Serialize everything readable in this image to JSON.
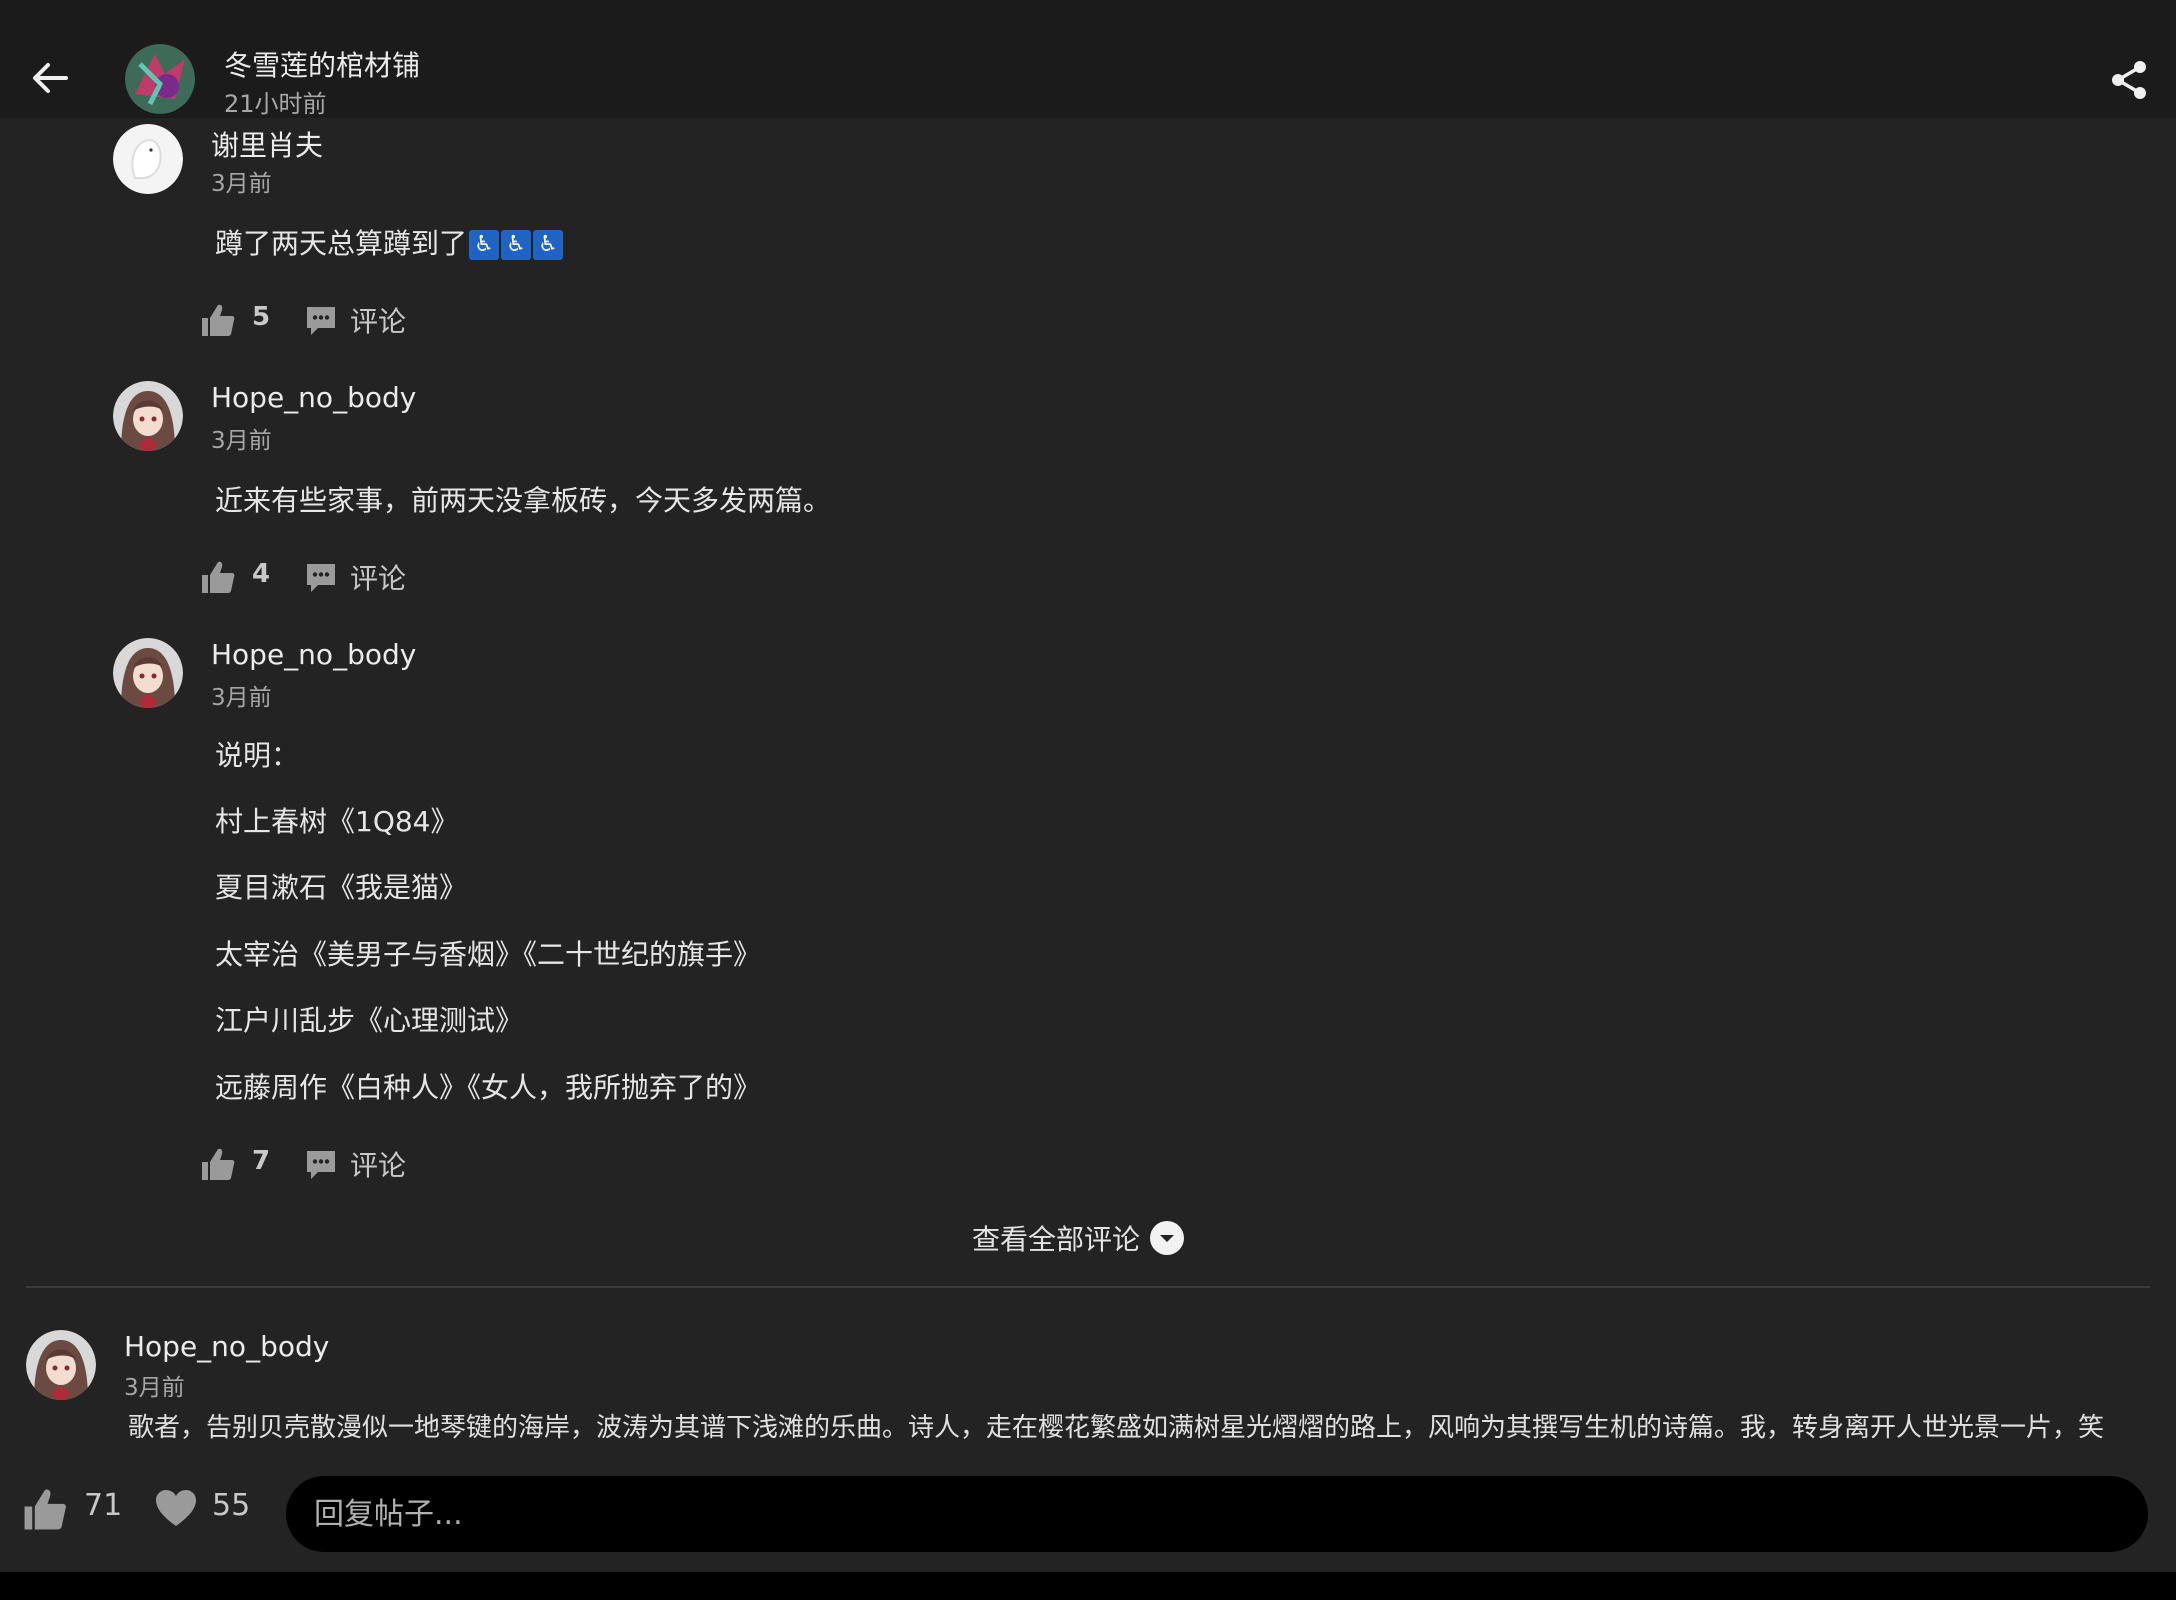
{
  "header": {
    "author_name": "冬雪莲的棺材铺",
    "post_time": "21小时前"
  },
  "comments": [
    {
      "name": "谢里肖夫",
      "time": "3月前",
      "lines": [
        "蹲了两天总算蹲到了"
      ],
      "emoji": [
        "♿",
        "♿",
        "♿"
      ],
      "likes": "5",
      "comment_label": "评论"
    },
    {
      "name": "Hope_no_body",
      "time": "3月前",
      "lines": [
        "近来有些家事，前两天没拿板砖，今天多发两篇。"
      ],
      "likes": "4",
      "comment_label": "评论"
    },
    {
      "name": "Hope_no_body",
      "time": "3月前",
      "lines": [
        "说明：",
        "村上春树《1Q84》",
        "夏目漱石《我是猫》",
        "太宰治《美男子与香烟》《二十世纪的旗手》",
        "江户川乱步《心理测试》",
        "远藤周作《白种人》《女人，我所抛弃了的》"
      ],
      "likes": "7",
      "comment_label": "评论"
    }
  ],
  "view_all_label": "查看全部评论",
  "reply_post": {
    "name": "Hope_no_body",
    "time": "3月前",
    "body": "歌者，告别贝壳散漫似一地琴键的海岸，波涛为其谱下浅滩的乐曲。诗人，走在樱花繁盛如满树星光熠熠的路上，风响为其撰写生机的诗篇。我，转身离开人世光景一片，笑着，笑里藏着悲伤，转身离去，世间万物终将归于沉寂，而我将在沉寂中寻找永恒的光。"
  },
  "bottom_bar": {
    "likes": "71",
    "favorites": "55",
    "reply_placeholder": "回复帖子..."
  }
}
